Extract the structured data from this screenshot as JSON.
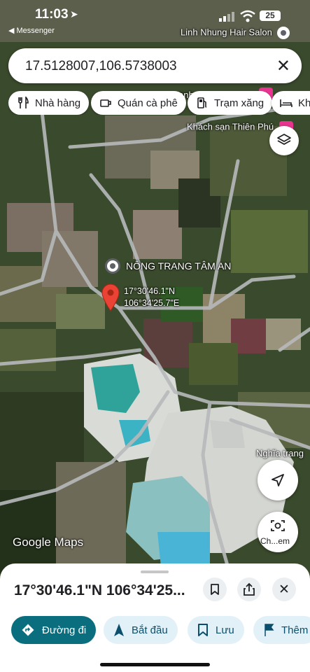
{
  "status_bar": {
    "time": "11:03",
    "back_app": "◀ Messenger",
    "battery": "25"
  },
  "map_labels": {
    "place_top": "Linh Nhung Hair Salon",
    "hotel_partial": "anh",
    "hotel": "Khách sạn Thiên Phú",
    "poi": "NÔNG TRANG TÂM AN",
    "coord_lat": "17°30'46.1\"N",
    "coord_lng": "106°34'25.7\"E",
    "cemetery": "Nghĩa trang",
    "logo": "Google Maps"
  },
  "search": {
    "query": "17.5128007,106.5738003"
  },
  "chips": [
    {
      "label": "Nhà hàng",
      "icon": "fork-knife-icon"
    },
    {
      "label": "Quán cà phê",
      "icon": "coffee-cup-icon"
    },
    {
      "label": "Trạm xăng",
      "icon": "gas-pump-icon"
    },
    {
      "label": "Kha",
      "icon": "bed-icon"
    }
  ],
  "lens_button": {
    "label": "Ch...em"
  },
  "sheet": {
    "title": "17°30'46.1\"N 106°34'25..."
  },
  "actions": [
    {
      "label": "Đường đi",
      "icon": "directions-icon"
    },
    {
      "label": "Bắt đầu",
      "icon": "navigation-arrow-icon"
    },
    {
      "label": "Lưu",
      "icon": "bookmark-icon"
    },
    {
      "label": "Thêm",
      "icon": "flag-icon"
    }
  ],
  "colors": {
    "primary_button": "#0b6e7f",
    "tonal_button": "#e2f1f7",
    "pin": "#ea4335",
    "road": "#b7b9bb"
  }
}
